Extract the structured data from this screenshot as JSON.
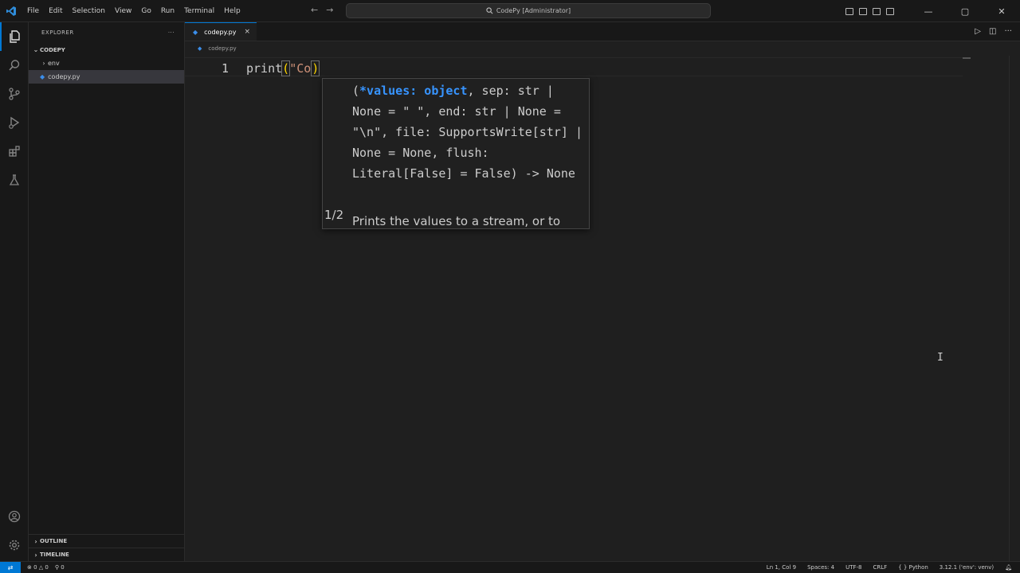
{
  "menu": [
    "File",
    "Edit",
    "Selection",
    "View",
    "Go",
    "Run",
    "Terminal",
    "Help"
  ],
  "command_center": {
    "text": "CodePy [Administrator]"
  },
  "sidebar": {
    "header": "EXPLORER",
    "more": "···",
    "folder": "CODEPY",
    "items": [
      {
        "label": "env"
      },
      {
        "label": "codepy.py"
      }
    ],
    "outline": "OUTLINE",
    "timeline": "TIMELINE"
  },
  "editor": {
    "tab_label": "codepy.py",
    "tab_close": "×",
    "breadcrumb": "codepy.py",
    "line_number": "1",
    "code_fn": "print",
    "code_open": "(",
    "code_string": "\"Co",
    "code_close": ")"
  },
  "signature_help": {
    "counter": "1/2",
    "open_paren": "(",
    "active_param": "*values: object",
    "rest": ", sep: str | None = \" \", end: str | None = \"\\n\", file: SupportsWrite[str] | None = None, flush: Literal[False] = False) -> None",
    "doc": "Prints the values to a stream, or to"
  },
  "status": {
    "errors": "⊗ 0 △ 0",
    "ports": "⚲ 0",
    "position": "Ln 1, Col 9",
    "spaces": "Spaces: 4",
    "encoding": "UTF-8",
    "eol": "CRLF",
    "language": "{ } Python",
    "interpreter": "3.12.1 ('env': venv)"
  },
  "colors": {
    "accent": "#0078d4",
    "active_param": "#3794ff",
    "bracket": "#ffd700",
    "string": "#ce9178"
  }
}
